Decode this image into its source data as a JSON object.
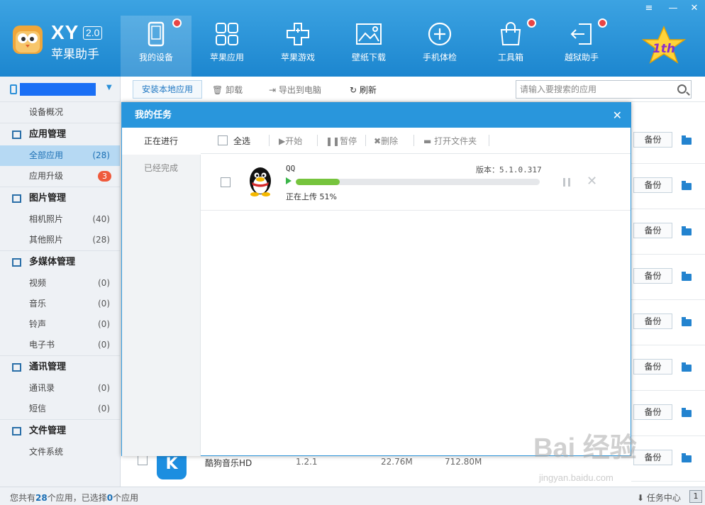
{
  "brand": {
    "logo_text": "XY",
    "version": "2.0",
    "name": "苹果助手"
  },
  "window_controls": [
    "≡",
    "—",
    "✕"
  ],
  "nav": [
    {
      "label": "我的设备",
      "icon": "phone-icon",
      "active": true,
      "dot": true
    },
    {
      "label": "苹果应用",
      "icon": "apps-grid-icon",
      "active": false,
      "dot": false
    },
    {
      "label": "苹果游戏",
      "icon": "gamepad-icon",
      "active": false,
      "dot": false
    },
    {
      "label": "壁纸下载",
      "icon": "picture-icon",
      "active": false,
      "dot": false
    },
    {
      "label": "手机体检",
      "icon": "health-check-icon",
      "active": false,
      "dot": false
    },
    {
      "label": "工具箱",
      "icon": "toolbox-icon",
      "active": false,
      "dot": true
    },
    {
      "label": "越狱助手",
      "icon": "jailbreak-icon",
      "active": false,
      "dot": true
    }
  ],
  "badge_text": "1th",
  "sidebar": {
    "overview": "设备概况",
    "sections": [
      {
        "title": "应用管理",
        "icon": "apps-icon",
        "items": [
          {
            "label": "全部应用",
            "count": "(28)",
            "active": true
          },
          {
            "label": "应用升级",
            "count": "3",
            "badge": true
          }
        ]
      },
      {
        "title": "图片管理",
        "icon": "image-icon",
        "items": [
          {
            "label": "相机照片",
            "count": "(40)"
          },
          {
            "label": "其他照片",
            "count": "(28)"
          }
        ]
      },
      {
        "title": "多媒体管理",
        "icon": "media-icon",
        "items": [
          {
            "label": "视频",
            "count": "(0)"
          },
          {
            "label": "音乐",
            "count": "(0)"
          },
          {
            "label": "铃声",
            "count": "(0)"
          },
          {
            "label": "电子书",
            "count": "(0)"
          }
        ]
      },
      {
        "title": "通讯管理",
        "icon": "chat-icon",
        "items": [
          {
            "label": "通讯录",
            "count": "(0)"
          },
          {
            "label": "短信",
            "count": "(0)"
          }
        ]
      },
      {
        "title": "文件管理",
        "icon": "file-icon",
        "items": [
          {
            "label": "文件系统",
            "count": ""
          }
        ]
      }
    ]
  },
  "toolbar": {
    "install_local": "安装本地应用",
    "uninstall": "卸载",
    "export": "导出到电脑",
    "refresh": "刷新",
    "search_placeholder": "请输入要搜索的应用"
  },
  "list": {
    "backup_label": "备份",
    "bottom_app": {
      "name": "酷狗音乐HD",
      "version": "1.2.1",
      "size": "22.76M",
      "data_size": "712.80M",
      "icon_letter": "K"
    }
  },
  "status": {
    "prefix": "您共有",
    "total": "28",
    "middle": "个应用，已选择",
    "selected": "0",
    "suffix": "个应用",
    "task_center": "任务中心",
    "task_count": "1"
  },
  "modal": {
    "title": "我的任务",
    "close": "✕",
    "tabs": [
      "正在进行",
      "已经完成"
    ],
    "toolbar": {
      "select_all": "全选",
      "start": "开始",
      "pause": "暂停",
      "delete": "删除",
      "open_folder": "打开文件夹"
    },
    "task": {
      "name": "QQ",
      "version": "版本：5.1.0.317",
      "status": "正在上传 51%",
      "progress": 0.18
    }
  },
  "watermark": {
    "main": "Bai 经验",
    "sub": "jingyan.baidu.com"
  }
}
